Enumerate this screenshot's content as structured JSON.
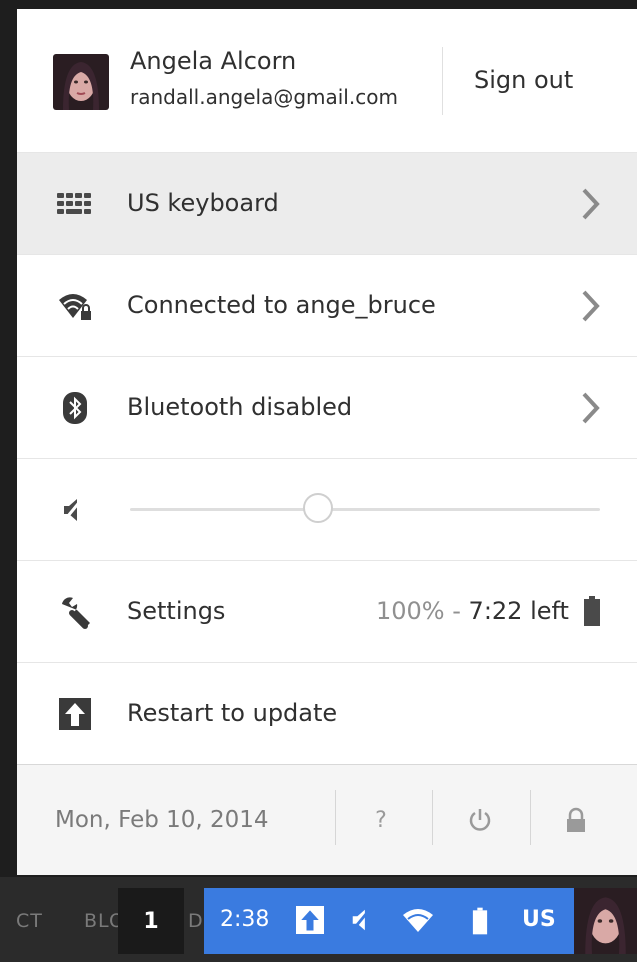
{
  "user": {
    "name": "Angela Alcorn",
    "email": "randall.angela@gmail.com",
    "sign_out_label": "Sign out"
  },
  "menu": {
    "keyboard": {
      "label": "US keyboard",
      "icon": "keyboard-icon"
    },
    "network": {
      "label": "Connected to ange_bruce",
      "icon": "wifi-locked-icon"
    },
    "bluetooth": {
      "label": "Bluetooth disabled",
      "icon": "bluetooth-icon"
    },
    "volume": {
      "icon": "volume-muted-icon",
      "level": 0.41
    },
    "settings": {
      "label": "Settings",
      "icon": "wrench-icon"
    },
    "battery": {
      "percent": "100%",
      "separator": " - ",
      "time_left": "7:22 left",
      "icon": "battery-icon"
    },
    "update": {
      "label": "Restart to update",
      "icon": "update-arrow-icon"
    }
  },
  "footer": {
    "date": "Mon, Feb 10, 2014",
    "help_label": "?",
    "power_icon": "power-icon",
    "lock_icon": "lock-icon"
  },
  "shelf": {
    "bg_text_left": "CT",
    "bg_text_mid": "BLOG",
    "bg_text_d": "D",
    "workspace_number": "1",
    "time": "2:38",
    "ime_label": "US"
  },
  "colors": {
    "tray_blue": "#3a7be0",
    "highlight_row": "#ececec"
  }
}
